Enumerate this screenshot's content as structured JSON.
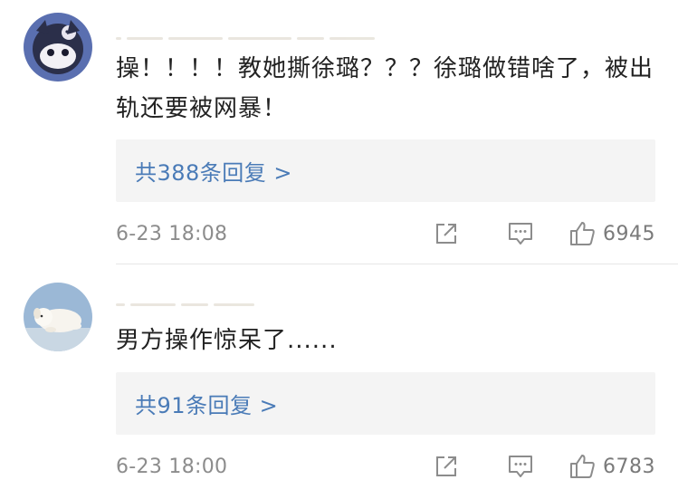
{
  "comments": [
    {
      "avatar": "anime-character-avatar",
      "text": "操！！！！教她撕徐璐？？？徐璐做错啥了，被出轨还要被网暴！",
      "replies_label": "共388条回复 >",
      "timestamp": "6-23 18:08",
      "likes": "6945"
    },
    {
      "avatar": "white-dog-avatar",
      "text": "男方操作惊呆了......",
      "replies_label": "共91条回复 >",
      "timestamp": "6-23 18:00",
      "likes": "6783"
    }
  ],
  "icons": {
    "share": "share-icon",
    "comment": "comment-icon",
    "like": "thumbs-up-icon"
  },
  "colors": {
    "text": "#222222",
    "link": "#4a7bb7",
    "meta": "#8c8c8c",
    "reply_bg": "#f4f4f4"
  }
}
